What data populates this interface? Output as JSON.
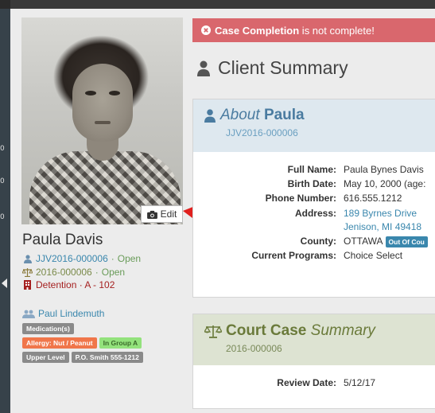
{
  "alert": {
    "bold": "Case Completion",
    "rest": " is not complete!",
    "color": "#d9676d"
  },
  "summary": {
    "title": "Client Summary"
  },
  "photo": {
    "edit_label": "Edit"
  },
  "profile": {
    "name": "Paula Davis",
    "case_id": "JJV2016-000006",
    "case_status": "Open",
    "court_case_id": "2016-000006",
    "court_status": "Open",
    "detention": "Detention · A - 102",
    "worker": "Paul Lindemuth",
    "separator": "·",
    "badges": [
      {
        "label": "Medication(s)",
        "style": "gray"
      },
      {
        "label": "Allergy: Nut / Peanut",
        "style": "orange"
      },
      {
        "label": "In Group A",
        "style": "green"
      },
      {
        "label": "Upper Level",
        "style": "gray"
      },
      {
        "label": "P.O. Smith 555-1212",
        "style": "gray"
      }
    ]
  },
  "about": {
    "prefix": "About",
    "name": "Paula",
    "id": "JJV2016-000006",
    "fields": {
      "full_name": {
        "label": "Full Name:",
        "value": "Paula Bynes Davis"
      },
      "birth_date": {
        "label": "Birth Date:",
        "value": "May 10, 2000 (age:"
      },
      "phone": {
        "label": "Phone Number:",
        "value": "616.555.1212"
      },
      "address": {
        "label": "Address:",
        "line1": "189 Byrnes Drive",
        "line2": "Jenison, MI 49418"
      },
      "county": {
        "label": "County:",
        "value": "OTTAWA",
        "tag": "Out Of Cou"
      },
      "programs": {
        "label": "Current Programs:",
        "value": "Choice Select"
      }
    }
  },
  "court": {
    "title_bold": "Court Case",
    "title_italic": "Summary",
    "id": "2016-000006",
    "review_label": "Review Date:",
    "review_value": "5/12/17"
  },
  "sidebar_markers": [
    "0",
    "0",
    "0"
  ],
  "colors": {
    "link": "#3a87ad",
    "about_header": "#dee8ef",
    "court_header": "#dde3d2"
  }
}
